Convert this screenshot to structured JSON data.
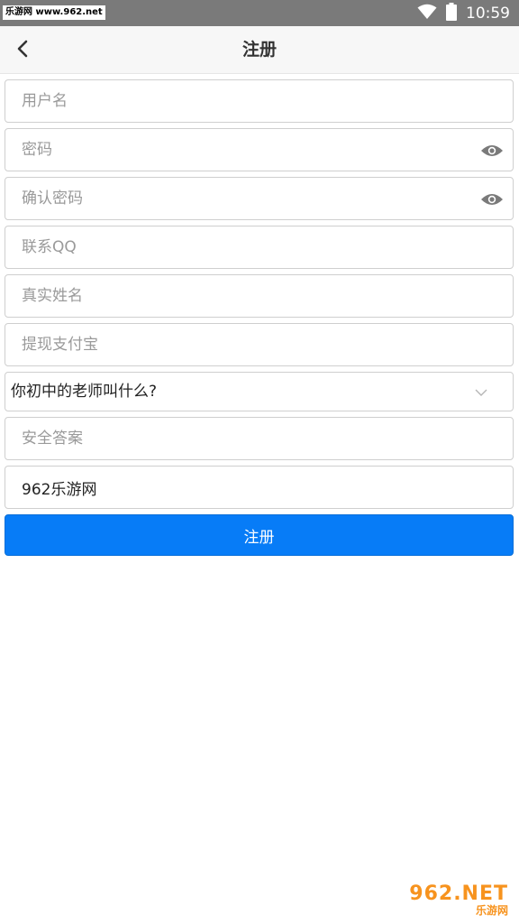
{
  "statusbar": {
    "watermark": "乐游网 www.962.net",
    "time": "10:59"
  },
  "appbar": {
    "title": "注册"
  },
  "form": {
    "username_placeholder": "用户名",
    "password_placeholder": "密码",
    "confirm_password_placeholder": "确认密码",
    "qq_placeholder": "联系QQ",
    "realname_placeholder": "真实姓名",
    "alipay_placeholder": "提现支付宝",
    "security_question": "你初中的老师叫什么?",
    "security_answer_placeholder": "安全答案",
    "invite_value": "962乐游网",
    "submit_label": "注册"
  },
  "watermark_br": {
    "brand": "962.NET",
    "sub": "乐游网"
  },
  "colors": {
    "accent": "#077cf7",
    "statusbar": "#7a7a7a"
  }
}
